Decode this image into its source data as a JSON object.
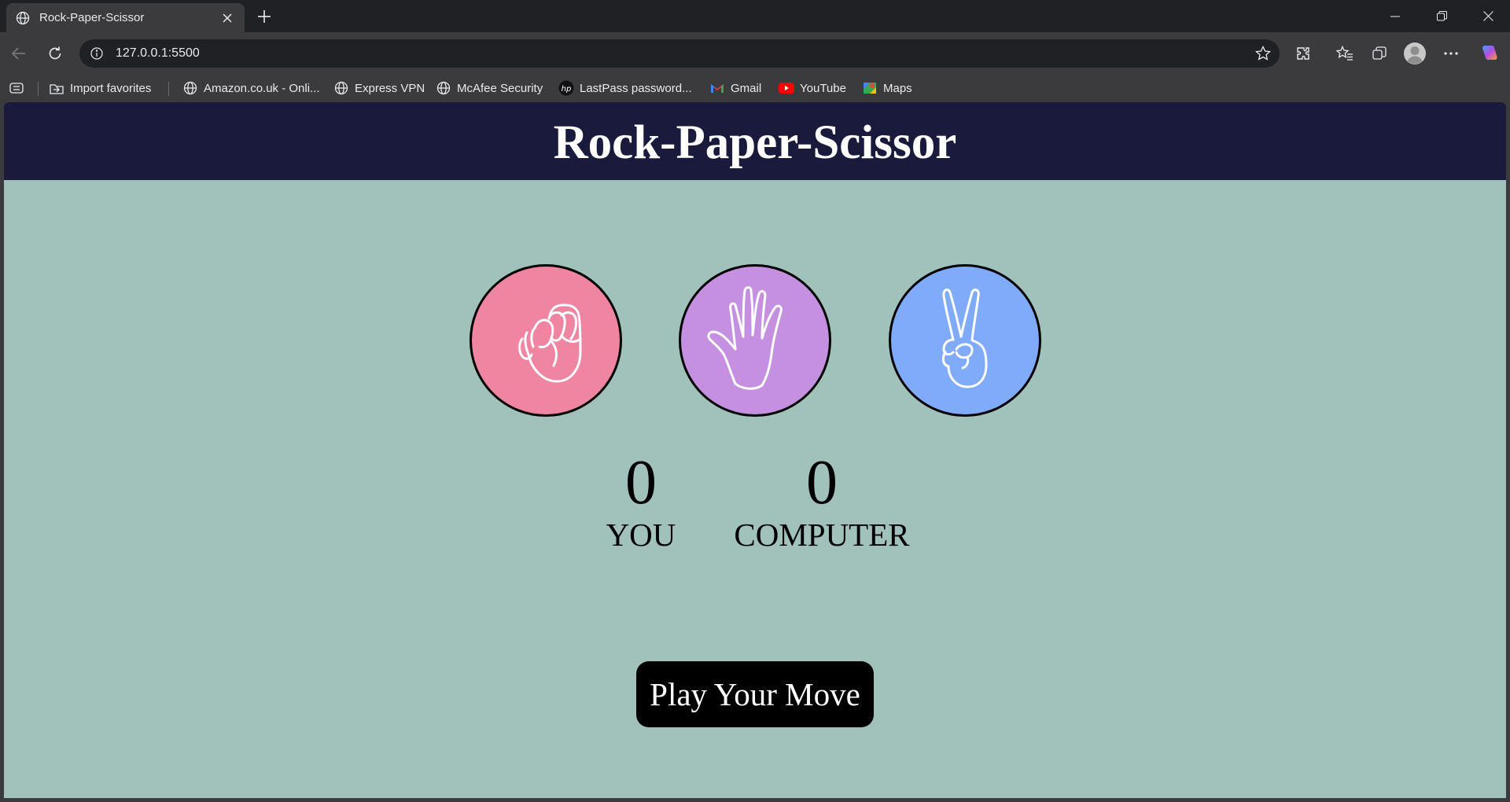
{
  "browser": {
    "tab_title": "Rock-Paper-Scissor",
    "url": "127.0.0.1:5500",
    "bookmarks": [
      {
        "label": "Import favorites",
        "icon": "import-icon"
      },
      {
        "label": "Amazon.co.uk - Onli...",
        "icon": "globe-icon"
      },
      {
        "label": "Express VPN",
        "icon": "globe-icon"
      },
      {
        "label": "McAfee Security",
        "icon": "globe-icon"
      },
      {
        "label": "LastPass password...",
        "icon": "hp-icon"
      },
      {
        "label": "Gmail",
        "icon": "gmail-icon"
      },
      {
        "label": "YouTube",
        "icon": "youtube-icon"
      },
      {
        "label": "Maps",
        "icon": "maps-icon"
      }
    ]
  },
  "page": {
    "title": "Rock-Paper-Scissor",
    "choices": [
      {
        "id": "rock",
        "icon": "fist-icon",
        "color": "#f085a2"
      },
      {
        "id": "paper",
        "icon": "open-hand-icon",
        "color": "#c490df"
      },
      {
        "id": "scissors",
        "icon": "peace-hand-icon",
        "color": "#80abfb"
      }
    ],
    "scores": {
      "user_score": "0",
      "user_label": "YOU",
      "computer_score": "0",
      "computer_label": "COMPUTER"
    },
    "play_button": "Play Your Move",
    "colors": {
      "header_bg": "#1a1a3d",
      "page_bg": "#a1c2bb",
      "button_bg": "#000000"
    }
  }
}
